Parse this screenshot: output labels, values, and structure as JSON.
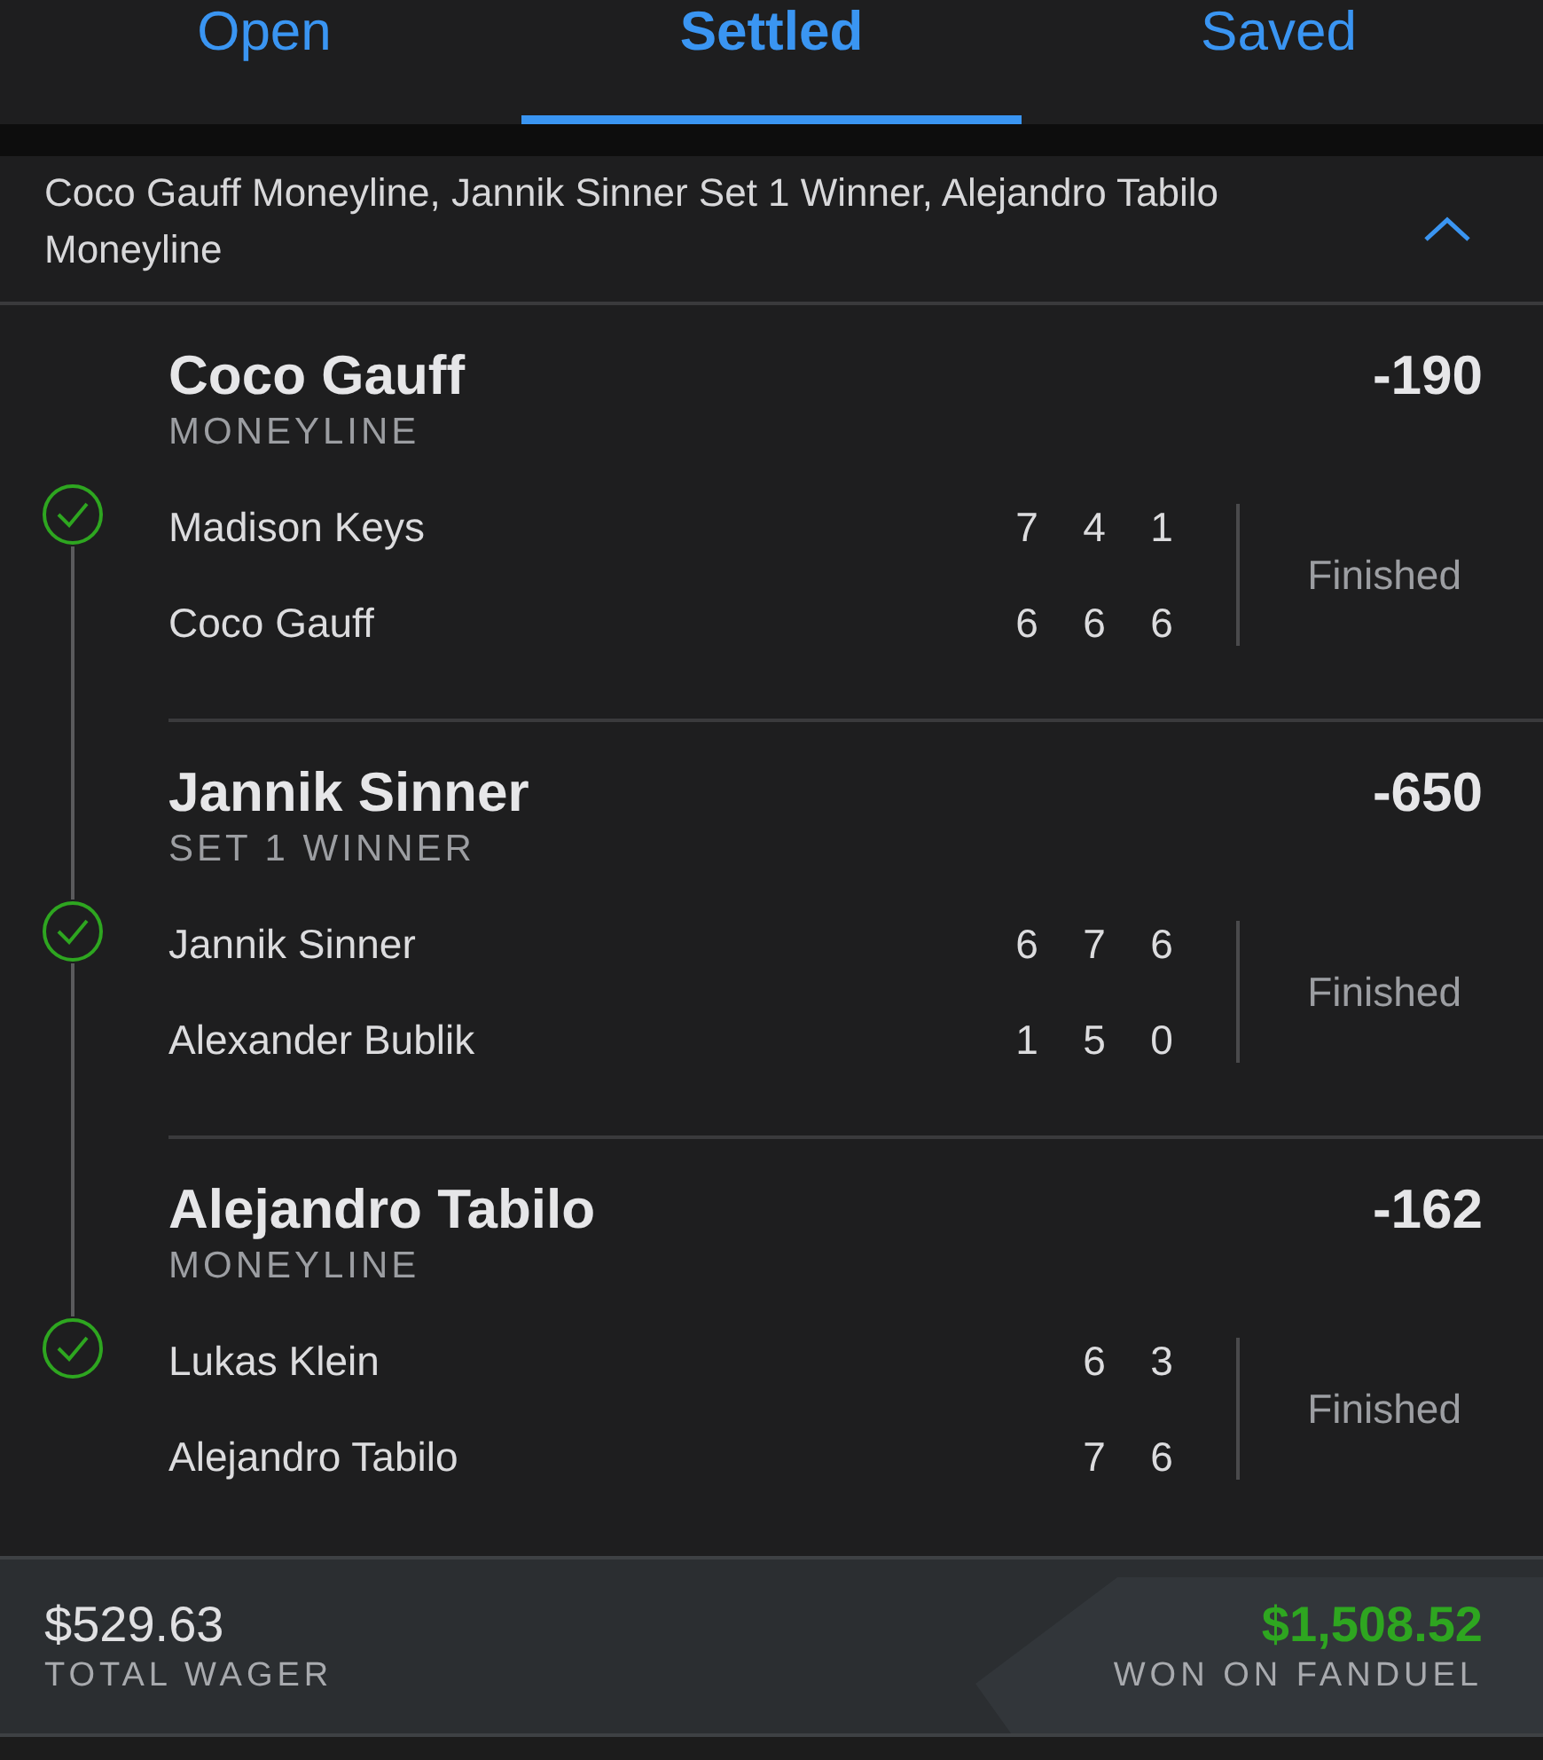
{
  "tabs": [
    {
      "label": "Open",
      "selected": false
    },
    {
      "label": "Settled",
      "selected": true
    },
    {
      "label": "Saved",
      "selected": false
    }
  ],
  "summary": {
    "text": "Coco Gauff Moneyline, Jannik Sinner Set 1 Winner, Alejandro Tabilo Moneyline",
    "expanded": true
  },
  "legs": [
    {
      "selection": "Coco Gauff",
      "market": "MONEYLINE",
      "odds": "-190",
      "won": true,
      "status": "Finished",
      "players": [
        {
          "name": "Madison Keys",
          "scores": [
            "7",
            "4",
            "1"
          ]
        },
        {
          "name": "Coco Gauff",
          "scores": [
            "6",
            "6",
            "6"
          ]
        }
      ]
    },
    {
      "selection": "Jannik Sinner",
      "market": "SET 1 WINNER",
      "odds": "-650",
      "won": true,
      "status": "Finished",
      "players": [
        {
          "name": "Jannik Sinner",
          "scores": [
            "6",
            "7",
            "6"
          ]
        },
        {
          "name": "Alexander Bublik",
          "scores": [
            "1",
            "5",
            "0"
          ]
        }
      ]
    },
    {
      "selection": "Alejandro Tabilo",
      "market": "MONEYLINE",
      "odds": "-162",
      "won": true,
      "status": "Finished",
      "players": [
        {
          "name": "Lukas Klein",
          "scores": [
            "6",
            "3"
          ]
        },
        {
          "name": "Alejandro Tabilo",
          "scores": [
            "7",
            "6"
          ]
        }
      ]
    }
  ],
  "footer": {
    "wager": "$529.63",
    "wager_label": "TOTAL WAGER",
    "payout": "$1,508.52",
    "payout_label": "WON ON FANDUEL"
  }
}
